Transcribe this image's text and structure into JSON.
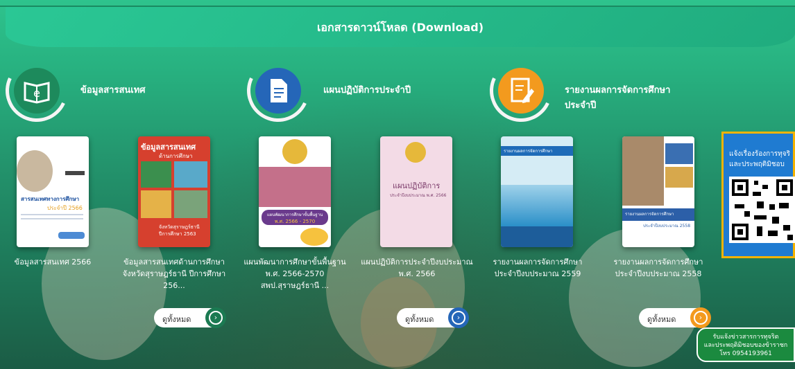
{
  "header": {
    "title": "เอกสารดาวน์โหลด (Download)"
  },
  "categories": [
    {
      "label": "ข้อมูลสารสนเทศ",
      "icon": "e-book-icon",
      "color": "#1d8a5c"
    },
    {
      "label": "แผนปฏิบัติการประจำปี",
      "icon": "document-icon",
      "color": "#2566b8"
    },
    {
      "label": "รายงานผลการจัดการศึกษา",
      "label2": "ประจำปี",
      "icon": "edit-report-icon",
      "color": "#f39a1e"
    }
  ],
  "cards": [
    {
      "caption": [
        "ข้อมูลสารสนเทศ 2566"
      ],
      "cover_title": "สารสนเทศทางการศึกษา",
      "cover_sub": "ประจำปี 2566"
    },
    {
      "caption": [
        "ข้อมูลสารสนเทศด้านการศึกษา",
        "จังหวัดสุราษฎร์ธานี ปีการศึกษา",
        "256..."
      ],
      "cover_title": "ข้อมูลสารสนเทศ",
      "cover_sub": "ด้านการศึกษา",
      "cover_foot": "จังหวัดสุราษฎร์ธานี",
      "cover_foot2": "ปีการศึกษา 2563"
    },
    {
      "caption": [
        "แผนพัฒนาการศึกษาขั้นพื้นฐาน",
        "พ.ศ. 2566-2570",
        "สพป.สุราษฎร์ธานี ..."
      ],
      "cover_title": "แผนพัฒนาการศึกษาขั้นพื้นฐาน",
      "cover_sub": "พ.ศ. 2566 - 2570"
    },
    {
      "caption": [
        "แผนปฏิบัติการประจำปีงบประมาณ",
        "พ.ศ. 2566"
      ],
      "cover_title": "แผนปฏิบัติการ",
      "cover_sub": "ประจำปีงบประมาณ พ.ศ. 2566"
    },
    {
      "caption": [
        "รายงานผลการจัดการศึกษา",
        "ประจำปีงบประมาณ 2559"
      ],
      "cover_title": "รายงานผลการจัดการศึกษา"
    },
    {
      "caption": [
        "รายงานผลการจัดการศึกษา",
        "ประจำปีงบประมาณ 2558"
      ],
      "cover_title": "รายงานผลการจัดการศึกษา",
      "cover_sub": "ประจำปีงบประมาณ 2558"
    }
  ],
  "buttons": [
    {
      "label": "ดูทั้งหมด",
      "color": "#1b7a52"
    },
    {
      "label": "ดูทั้งหมด",
      "color": "#2566b8"
    },
    {
      "label": "ดูทั้งหมด",
      "color": "#f39a1e"
    }
  ],
  "qr_panel": {
    "line1": "แจ้งเรื่องร้องการทุจริ",
    "line2": "และประพฤติมิชอบ"
  },
  "news_button": {
    "line1": "รับแจ้งข่าวสารการทุจริต",
    "line2": "และประพฤติมิชอบของข้าราชก",
    "line3": "โทร 0954193961"
  }
}
